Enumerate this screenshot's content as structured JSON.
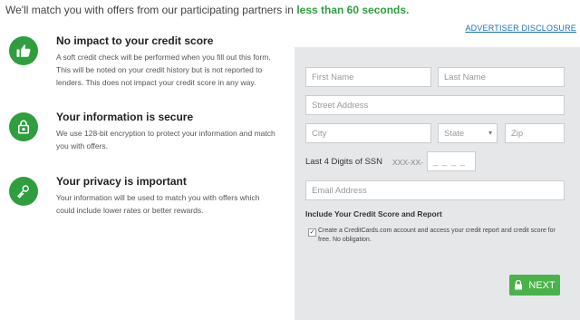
{
  "intro": {
    "text": "We'll match you with offers from our participating partners in ",
    "highlight": "less than 60 seconds."
  },
  "advertiser_disclosure": "ADVERTISER DISCLOSURE",
  "features": [
    {
      "icon": "thumbs-up-icon",
      "title": "No impact to your credit score",
      "text": "A soft credit check will be performed when you fill out this form. This will be noted on your credit history but is not reported to lenders. This does not impact your credit score in any way."
    },
    {
      "icon": "lock-icon",
      "title": "Your information is secure",
      "text": "We use 128-bit encryption to protect your information and match you with offers."
    },
    {
      "icon": "key-icon",
      "title": "Your privacy is important",
      "text": "Your information will be used to match you with offers which could include lower rates or better rewards."
    }
  ],
  "form": {
    "first_name_placeholder": "First Name",
    "last_name_placeholder": "Last Name",
    "street_placeholder": "Street Address",
    "city_placeholder": "City",
    "state_placeholder": "State",
    "zip_placeholder": "Zip",
    "ssn_label": "Last 4 Digits of SSN",
    "ssn_prefix": "XXX-XX-",
    "ssn_placeholder": "_ _ _ _",
    "email_placeholder": "Email Address",
    "score_title": "Include Your Credit Score and Report",
    "consent_checkmark": "✓",
    "consent_text": "Create a CreditCards.com account and access your credit report and credit score for free. No obligation.",
    "next_label": "NEXT"
  },
  "colors": {
    "accent": "#2e9e3e",
    "button": "#49b34a",
    "panel": "#e5e7e9",
    "link": "#1a6fb5"
  }
}
